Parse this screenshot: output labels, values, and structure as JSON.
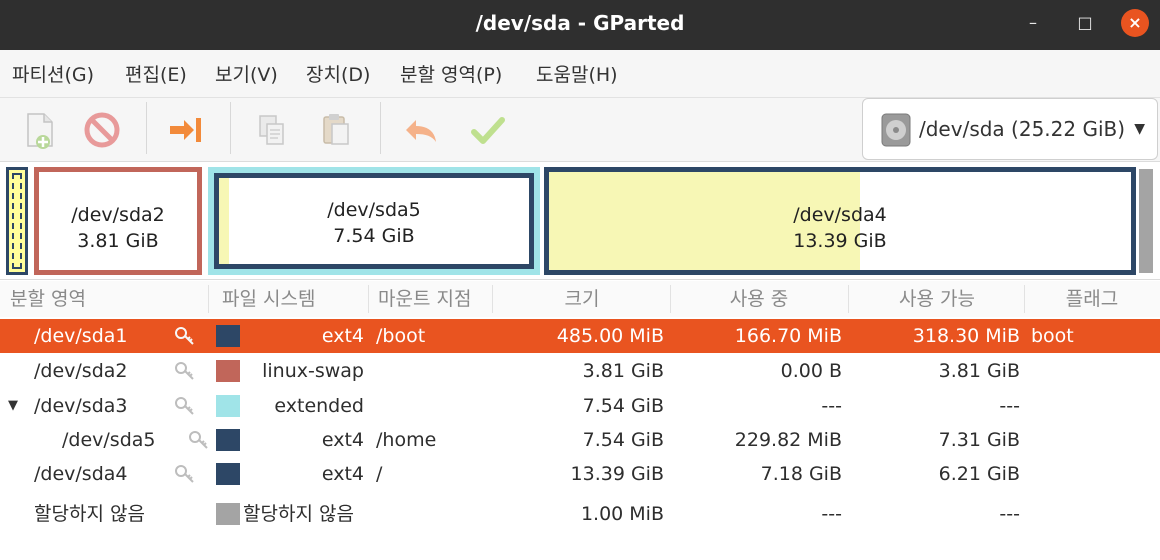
{
  "window": {
    "title": "/dev/sda - GParted",
    "controls": {
      "minimize": "–",
      "maximize": "□",
      "close": "×"
    }
  },
  "menubar": {
    "items": [
      {
        "label": "파티션(G)"
      },
      {
        "label": "편집(E)"
      },
      {
        "label": "보기(V)"
      },
      {
        "label": "장치(D)"
      },
      {
        "label": "분할 영역(P)"
      },
      {
        "label": "도움말(H)"
      }
    ]
  },
  "toolbar": {
    "buttons": [
      {
        "name": "new-partition",
        "icon": "new-document-icon",
        "enabled": false
      },
      {
        "name": "delete-partition",
        "icon": "delete-no-entry-icon",
        "enabled": true
      },
      {
        "name": "resize-move",
        "icon": "resize-arrow-icon",
        "enabled": true
      },
      {
        "name": "copy",
        "icon": "copy-icon",
        "enabled": false
      },
      {
        "name": "paste",
        "icon": "paste-icon",
        "enabled": false
      },
      {
        "name": "undo",
        "icon": "undo-arrow-icon",
        "enabled": false
      },
      {
        "name": "apply",
        "icon": "apply-check-icon",
        "enabled": false
      }
    ],
    "device_selector": {
      "label": "/dev/sda (25.22 GiB)",
      "icon": "harddisk-icon"
    }
  },
  "graph": {
    "partitions": [
      {
        "name": "/dev/sda2",
        "size": "3.81 GiB",
        "border_color": "#c1665a",
        "used_fraction": 0
      },
      {
        "name": "/dev/sda5",
        "size": "7.54 GiB",
        "border_color": "#2d4766",
        "outer_color": "#a0e4e8",
        "used_fraction": 0.03
      },
      {
        "name": "/dev/sda4",
        "size": "13.39 GiB",
        "border_color": "#2d4766",
        "used_fraction": 0.54
      }
    ],
    "colors": {
      "used": "#f7f7b5",
      "ext4": "#2d4766",
      "swap": "#c1665a",
      "extended": "#a0e4e8",
      "unallocated": "#a4a4a4"
    }
  },
  "table": {
    "columns": [
      "분할 영역",
      "파일 시스템",
      "마운트 지점",
      "크기",
      "사용 중",
      "사용 가능",
      "플래그"
    ],
    "rows": [
      {
        "partition": "/dev/sda1",
        "fs": "ext4",
        "swatch": "#2d4766",
        "mount": "/boot",
        "size": "485.00 MiB",
        "used": "166.70 MiB",
        "available": "318.30 MiB",
        "flags": "boot",
        "selected": true,
        "key": true
      },
      {
        "partition": "/dev/sda2",
        "fs": "linux-swap",
        "swatch": "#c1665a",
        "mount": "",
        "size": "3.81 GiB",
        "used": "0.00 B",
        "available": "3.81 GiB",
        "flags": "",
        "selected": false,
        "key": true
      },
      {
        "partition": "/dev/sda3",
        "fs": "extended",
        "swatch": "#a0e4e8",
        "mount": "",
        "size": "7.54 GiB",
        "used": "---",
        "available": "---",
        "flags": "",
        "selected": false,
        "key": true,
        "expanded": true
      },
      {
        "partition": "/dev/sda5",
        "fs": "ext4",
        "swatch": "#2d4766",
        "mount": "/home",
        "size": "7.54 GiB",
        "used": "229.82 MiB",
        "available": "7.31 GiB",
        "flags": "",
        "selected": false,
        "key": true,
        "child": true
      },
      {
        "partition": "/dev/sda4",
        "fs": "ext4",
        "swatch": "#2d4766",
        "mount": "/",
        "size": "13.39 GiB",
        "used": "7.18 GiB",
        "available": "6.21 GiB",
        "flags": "",
        "selected": false,
        "key": true
      },
      {
        "partition": "할당하지 않음",
        "fs": "할당하지 않음",
        "swatch": "#a4a4a4",
        "mount": "",
        "size": "1.00 MiB",
        "used": "---",
        "available": "---",
        "flags": "",
        "selected": false,
        "key": false
      }
    ]
  }
}
